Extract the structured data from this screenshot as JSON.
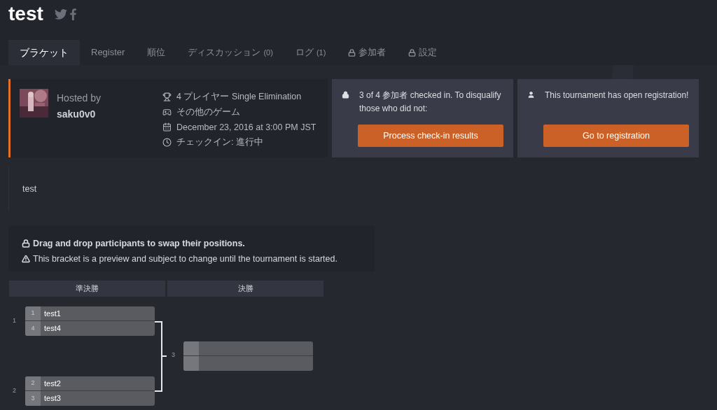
{
  "title": "test",
  "tabs": [
    {
      "label": "ブラケット",
      "selected": true,
      "locked": false
    },
    {
      "label": "Register",
      "selected": false,
      "locked": false
    },
    {
      "label": "順位",
      "selected": false,
      "locked": false
    },
    {
      "label": "ディスカッション",
      "count": "(0)",
      "selected": false,
      "locked": false
    },
    {
      "label": "ログ",
      "count": "(1)",
      "selected": false,
      "locked": false
    },
    {
      "label": "参加者",
      "selected": false,
      "locked": true
    },
    {
      "label": "設定",
      "selected": false,
      "locked": true
    }
  ],
  "host": {
    "label": "Hosted by",
    "name": "saku0v0"
  },
  "details": [
    {
      "kind": "format",
      "text": "4 プレイヤー Single Elimination"
    },
    {
      "kind": "game",
      "text": "その他のゲーム"
    },
    {
      "kind": "date",
      "text": "December 23, 2016 at 3:00 PM JST"
    },
    {
      "kind": "checkin",
      "text": "チェックイン: 進行中"
    }
  ],
  "cards": [
    {
      "kind": "checkin",
      "text": "3 of 4 参加者 checked in. To disqualify those who did not:",
      "button": "Process check-in results"
    },
    {
      "kind": "registration",
      "text": "This tournament has open registration!",
      "button": "Go to registration"
    }
  ],
  "description": "test",
  "notices": [
    {
      "kind": "lock",
      "text": "Drag and drop participants to swap their positions."
    },
    {
      "kind": "warning",
      "text": "This bracket is a preview and subject to change until the tournament is started."
    }
  ],
  "rounds": [
    {
      "label": "準決勝"
    },
    {
      "label": "決勝"
    }
  ],
  "matches": [
    {
      "number": "1",
      "players": [
        {
          "seed": "1",
          "name": "test1"
        },
        {
          "seed": "4",
          "name": "test4"
        }
      ]
    },
    {
      "number": "2",
      "players": [
        {
          "seed": "2",
          "name": "test2"
        },
        {
          "seed": "3",
          "name": "test3"
        }
      ]
    }
  ],
  "final": {
    "number": "3"
  }
}
